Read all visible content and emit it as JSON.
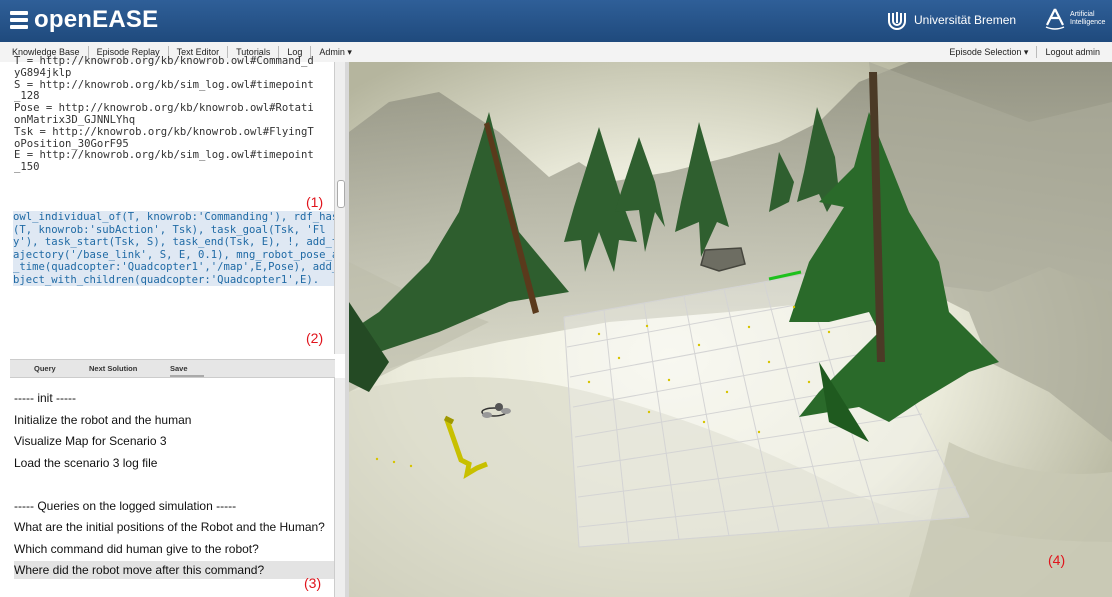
{
  "header": {
    "brand": "openEASE",
    "university": "Universität Bremen",
    "ai_label_1": "Artificial",
    "ai_label_2": "Intelligence"
  },
  "nav": {
    "left": [
      "Knowledge Base",
      "Episode Replay",
      "Text Editor",
      "Tutorials",
      "Log",
      "Admin ▾"
    ],
    "right": [
      "Episode Selection ▾",
      "Logout admin"
    ]
  },
  "results": [
    "T = http://knowrob.org/kb/knowrob.owl#Command_d",
    "yG894jklp",
    "S = http://knowrob.org/kb/sim_log.owl#timepoint",
    "_128",
    "Pose = http://knowrob.org/kb/knowrob.owl#Rotati",
    "onMatrix3D_GJNNLYhq",
    "Tsk = http://knowrob.org/kb/knowrob.owl#FlyingT",
    "oPosition_30GorF95",
    "E = http://knowrob.org/kb/sim_log.owl#timepoint",
    "_150"
  ],
  "query_text": "owl_individual_of(T, knowrob:'Commanding'), rdf_has(T, knowrob:'subAction', Tsk), task_goal(Tsk, 'Fly'), task_start(Tsk, S), task_end(Tsk, E), !, add_trajectory('/base_link', S, E, 0.1), mng_robot_pose_at_time(quadcopter:'Quadcopter1','/map',E,Pose), add_object_with_children(quadcopter:'Quadcopter1',E).",
  "tabs": {
    "query": "Query",
    "next": "Next Solution",
    "save": "Save"
  },
  "queries": [
    "----- init -----",
    "Initialize the robot and the human",
    "Visualize Map for Scenario 3",
    "Load the scenario 3 log file",
    "",
    "----- Queries on the logged simulation -----",
    "What are the initial positions of the Robot and the Human?",
    "Which command did human give to the robot?",
    "Where did the robot move after this command?"
  ],
  "annotations": {
    "a1": "(1)",
    "a2": "(2)",
    "a3": "(3)",
    "a4": "(4)"
  },
  "colors": {
    "header": "#1f4a7d",
    "annotation": "#e0141c"
  }
}
